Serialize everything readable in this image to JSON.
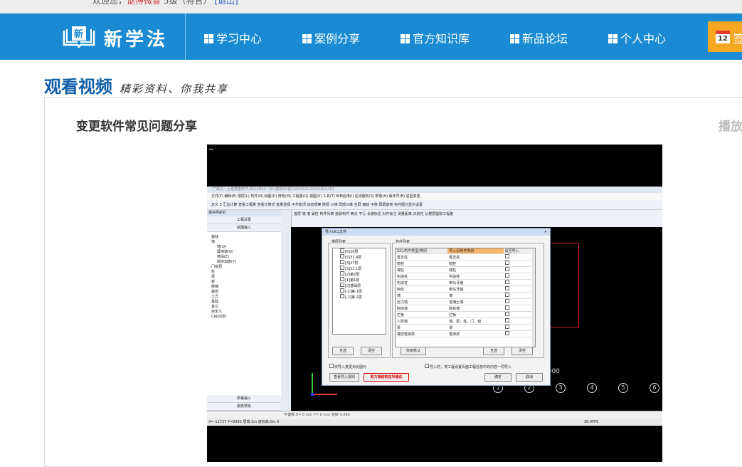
{
  "topbar": {
    "welcome": "欢迎您，",
    "user": "讴傅微鲁",
    "level": "5级（将官）",
    "logout": "[退出]"
  },
  "brand": {
    "name": "新学法",
    "badge": "新"
  },
  "nav": {
    "items": [
      "学习中心",
      "案例分享",
      "官方知识库",
      "新品论坛",
      "个人中心"
    ],
    "sign_day": "12",
    "sign_label": "签"
  },
  "page": {
    "title": "观看视频",
    "slogan": "精彩资料、你我共享"
  },
  "video": {
    "title": "变更软件常见问题分享",
    "side_label": "播放"
  },
  "software": {
    "window_title": "广联达—土建算量软件 GCL2013 - [D:\\案例\\工程1\\GCL\\GCL2013.GCL10]",
    "menu": "文件(F)  编辑(E)  楼层(L)  构件(N)  绘图(D)  修改(M)  工程量(Q)  视图(V)  工具(T)  BIM应用(I)  在线服务(S)  帮助(H)  版本号(B)  返回变更",
    "toolbar1": "定义  Σ 汇总计算  查看工程量  查看计算式  批量选择  平齐板顶  动态观察  俯视  三维  局部三维  全屏  缩放  平移  屏幕旋转  构件图元显示设置",
    "toolbar2": "首层  墙  墙  属性  构件列表  拾取构件  两点  平行  长度标注  对齐标注  测量距离  识别柱  从楼层提取工程量",
    "left_header": "模块导航栏",
    "left_rows": [
      "工程设置",
      "绘图输入"
    ],
    "tree": [
      "轴线",
      "墙",
      "墙(Q)",
      "幕墙墙(Q)",
      "墙垛(E)",
      "砌体加筋(Y)",
      "门窗洞",
      "柱",
      "梁",
      "板",
      "楼梯",
      "装修",
      "土方",
      "基础",
      "其它",
      "自定义",
      "CAD识别"
    ],
    "left_bottom": [
      "表格输入",
      "报表预览"
    ],
    "status1": "不偏移   X= 0   mm  Y= 0   mm  旋转 0.000",
    "status2": "X=-11727 Y=8392   层高:3m   底标高:0m   0",
    "fps": "38.4FPS",
    "axes": [
      "1",
      "2",
      "3",
      "4",
      "5",
      "6"
    ],
    "dimension": "3000"
  },
  "dialog": {
    "title": "导入GCL文件",
    "floor_group": "楼层列表",
    "floors": [
      "[6]26层",
      "[5]31.4层",
      "[4]27层",
      "[3]22.1层",
      "[2]第2层",
      "[1]第1层",
      "[0]基础层",
      "[-1]第-1层",
      "[-2]第-2层"
    ],
    "comp_group": "构件列表",
    "columns": [
      "GCL构件类型/类别",
      "导入后构件类别",
      "是否导入"
    ],
    "rows": [
      [
        "框支柱",
        "框支柱"
      ],
      [
        "暗柱",
        "暗柱"
      ],
      [
        "端柱",
        "端柱"
      ],
      [
        "构造柱",
        "构造柱"
      ],
      [
        "构造柱",
        "带马牙槎"
      ],
      [
        "砌体",
        "带马牙槎"
      ],
      [
        "墙",
        "墙"
      ],
      [
        "剪力墙",
        "混凝土墙"
      ],
      [
        "砌体墙",
        "砌体墙"
      ],
      [
        "栏板",
        "栏板"
      ],
      [
        "人防墙",
        "墙、梁、柱、门、窗"
      ],
      [
        "梁",
        "梁"
      ],
      [
        "楼层框架梁",
        "框架梁"
      ]
    ],
    "select_all": "全选",
    "clear": "清空",
    "restore_default": "恢复默认",
    "opt1": "仅导入变更对比图元",
    "opt2": "导入时，将工程设置页面工程信息中的内容一同导入",
    "view_rules": "查看导入规则",
    "shear_tip": "剪力墙结构应导建议",
    "ok": "确定",
    "cancel": "取消"
  }
}
